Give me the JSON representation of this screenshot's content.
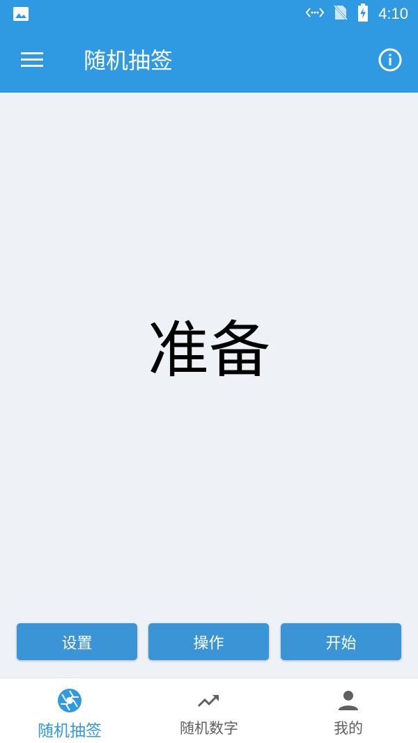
{
  "status_bar": {
    "time": "4:10",
    "icons": [
      "image-icon",
      "data-transfer-icon",
      "no-sim-icon",
      "battery-charging-icon"
    ]
  },
  "app_bar": {
    "title": "随机抽签",
    "menu_icon": "menu-icon",
    "info_icon": "info-icon"
  },
  "main": {
    "result_text": "准备"
  },
  "actions": {
    "settings_label": "设置",
    "operate_label": "操作",
    "start_label": "开始"
  },
  "bottom_nav": {
    "items": [
      {
        "label": "随机抽签",
        "icon": "shutter-icon",
        "active": true
      },
      {
        "label": "随机数字",
        "icon": "trending-up-icon",
        "active": false
      },
      {
        "label": "我的",
        "icon": "person-icon",
        "active": false
      }
    ]
  },
  "colors": {
    "primary": "#2f9ae2",
    "button": "#3a94d6",
    "background": "#eef2f6",
    "nav_inactive": "#606060"
  }
}
